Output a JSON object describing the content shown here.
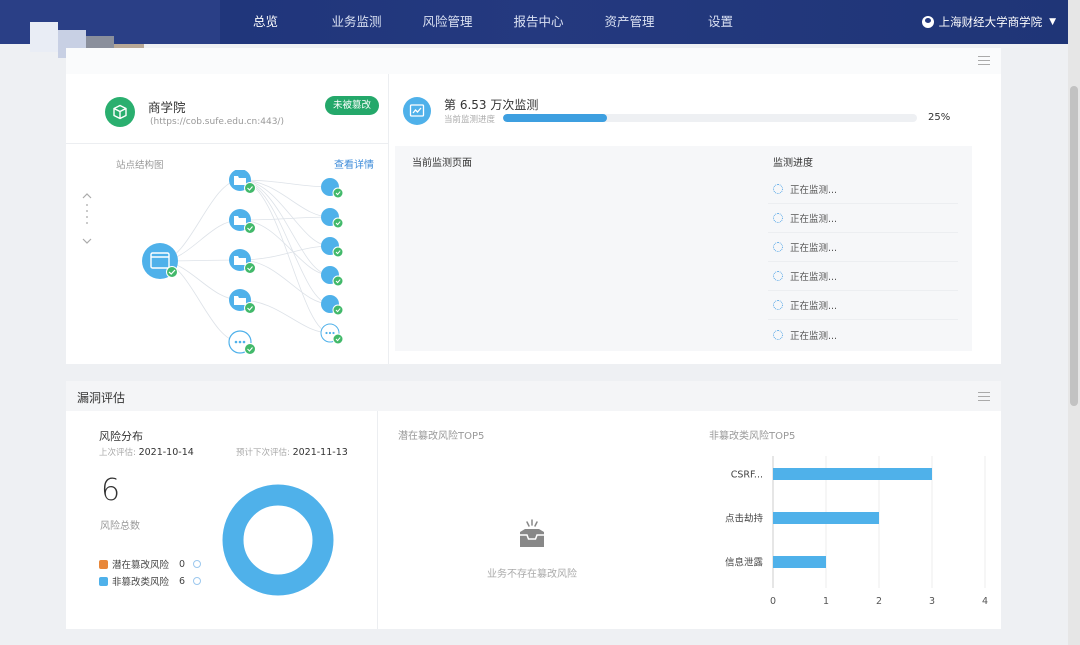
{
  "nav": {
    "items": [
      "总览",
      "业务监测",
      "风险管理",
      "报告中心",
      "资产管理",
      "设置"
    ],
    "active": 0,
    "user": "上海财经大学商学院"
  },
  "site": {
    "name": "商学院",
    "url": "(https://cob.sufe.edu.cn:443/)",
    "status_badge": "未被篡改",
    "structure_label": "站点结构图",
    "details_link": "查看详情"
  },
  "monitor": {
    "title": "第 6.53 万次监测",
    "progress_label": "当前监测进度",
    "progress_percent": 25,
    "progress_text": "25%",
    "table": {
      "col_page": "当前监测页面",
      "col_progress": "监测进度",
      "rows": [
        "正在监测...",
        "正在监测...",
        "正在监测...",
        "正在监测...",
        "正在监测...",
        "正在监测..."
      ]
    }
  },
  "vuln": {
    "section_title": "漏洞评估",
    "risk_title": "风险分布",
    "last_label": "上次评估:",
    "last_date": "2021-10-14",
    "next_label": "预计下次评估:",
    "next_date": "2021-11-13",
    "total": "6",
    "total_label": "风险总数",
    "legend": [
      {
        "label": "潜在篡改风险",
        "count": "0",
        "color": "#e8873a"
      },
      {
        "label": "非篡改类风险",
        "count": "6",
        "color": "#4fb1ea"
      }
    ],
    "tamper_top5_title": "潜在篡改风险TOP5",
    "empty_text": "业务不存在篡改风险",
    "nontamper_top5_title": "非篡改类风险TOP5"
  },
  "colors": {
    "nav_bg": "#24397f",
    "accent_blue": "#4fb1ea",
    "accent_green": "#2aaf6f",
    "orange": "#e8873a"
  },
  "chart_data": {
    "type": "bar",
    "orientation": "horizontal",
    "categories": [
      "CSRF...",
      "点击劫持",
      "信息泄露"
    ],
    "values": [
      3,
      2,
      1
    ],
    "xlim": [
      0,
      4
    ],
    "xticks": [
      0,
      1,
      2,
      3,
      4
    ],
    "grid": true
  }
}
